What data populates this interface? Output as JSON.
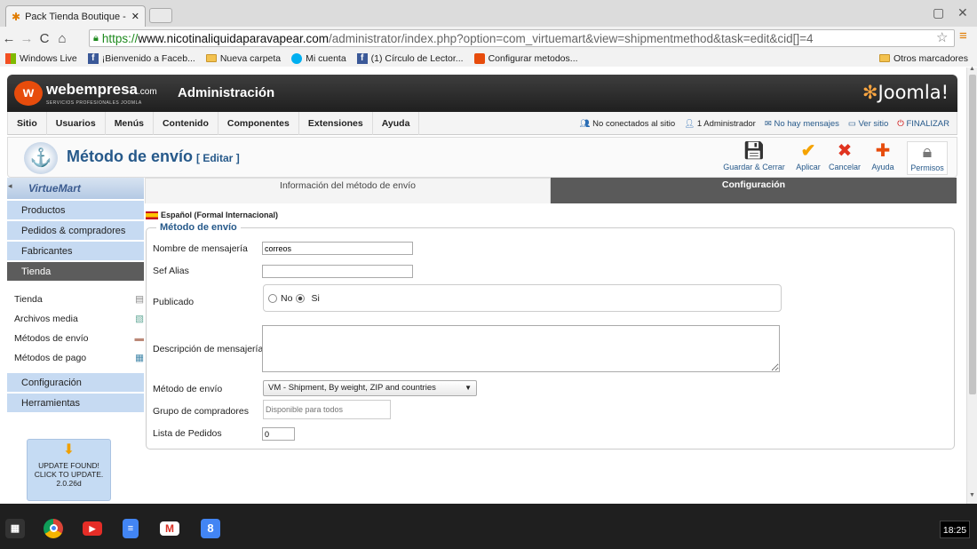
{
  "browser": {
    "tab_title": "Pack Tienda Boutique - Ad",
    "url_scheme": "https://",
    "url_host": "www.nicotinaliquidaparavapear.com",
    "url_path": "/administrator/index.php?option=com_virtuemart&view=shipmentmethod&task=edit&cid[]=4",
    "bookmarks": [
      "Windows Live",
      "¡Bienvenido a Faceb...",
      "Nueva carpeta",
      "Mi cuenta",
      "(1) Círculo de Lector...",
      "Configurar metodos..."
    ],
    "other_bookmarks": "Otros marcadores"
  },
  "header": {
    "brand": "webempresa",
    "brand_suffix": ".com",
    "brand_sub": "SERVICIOS PROFESIONALES JOOMLA",
    "title": "Administración",
    "joomla": "Joomla!"
  },
  "menu": {
    "items": [
      "Sitio",
      "Usuarios",
      "Menús",
      "Contenido",
      "Componentes",
      "Extensiones",
      "Ayuda"
    ],
    "status": {
      "visitors": "No conectados al sitio",
      "admins": "1 Administrador",
      "messages": "No hay mensajes",
      "view_site": "Ver sitio",
      "logout": "FINALIZAR"
    }
  },
  "toolbar": {
    "title": "Método de envío",
    "subtitle": "[ Editar ]",
    "save_close": "Guardar & Cerrar",
    "apply": "Aplicar",
    "cancel": "Cancelar",
    "help": "Ayuda",
    "permissions": "Permisos"
  },
  "sidebar": {
    "logo": "VirtueMart",
    "sections": [
      "Productos",
      "Pedidos & compradores",
      "Fabricantes",
      "Tienda"
    ],
    "items": [
      "Tienda",
      "Archivos media",
      "Métodos de envío",
      "Métodos de pago"
    ],
    "bottom_sections": [
      "Configuración",
      "Herramientas"
    ],
    "update": {
      "line1": "UPDATE FOUND!",
      "line2": "CLICK TO UPDATE.",
      "version": "2.0.26d"
    }
  },
  "tabs": {
    "info": "Información del método de envío",
    "config": "Configuración"
  },
  "form": {
    "language": "Español (Formal Internacional)",
    "legend": "Método de envío",
    "name_label": "Nombre de mensajería",
    "name_value": "correos",
    "alias_label": "Sef Alias",
    "alias_value": "",
    "published_label": "Publicado",
    "published_no": "No",
    "published_yes": "Si",
    "published_selected": "Si",
    "description_label": "Descripción de mensajería",
    "method_label": "Método de envío",
    "method_value": "VM - Shipment, By weight, ZIP and countries",
    "group_label": "Grupo de compradores",
    "group_placeholder": "Disponible para todos",
    "order_label": "Lista de Pedidos",
    "order_value": "0"
  },
  "taskbar": {
    "time": "18:25"
  },
  "colors": {
    "accent_blue": "#26598a",
    "sidebar_blue": "#c6daf2",
    "header_dark": "#2a2a2a"
  }
}
